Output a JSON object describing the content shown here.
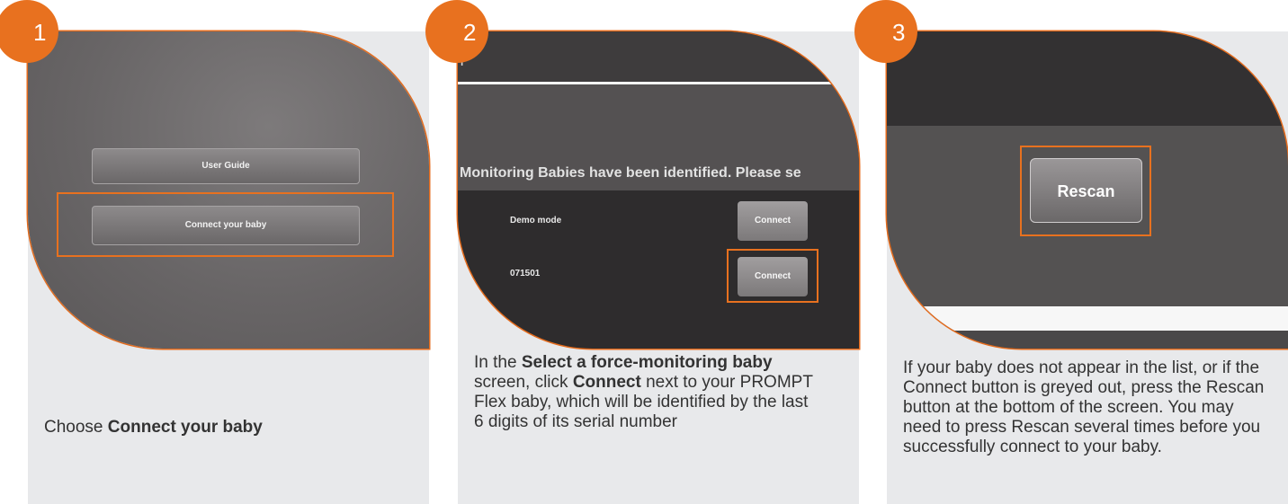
{
  "steps": [
    {
      "number": "1",
      "screen": {
        "buttons": [
          "User Guide",
          "Connect your baby"
        ]
      },
      "caption_prefix": "Choose ",
      "caption_bold": "Connect your baby"
    },
    {
      "number": "2",
      "screen": {
        "message": "Monitoring Babies have been identified. Please se",
        "rows": [
          {
            "label": "Demo mode",
            "button": "Connect"
          },
          {
            "label": "071501",
            "button": "Connect"
          }
        ]
      },
      "caption_parts": {
        "a": "In the ",
        "b": "Select a force-monitoring baby",
        "c": " screen, click ",
        "d": "Connect",
        "e": " next to your PROMPT Flex baby, which will be identified by the last 6 digits of its serial number"
      }
    },
    {
      "number": "3",
      "screen": {
        "button": "Rescan"
      },
      "caption": "If your baby does not appear in the list, or if the Connect button is greyed out, press the Rescan button at the bottom of the screen. You may need to press Rescan several times before you successfully connect to your baby."
    }
  ],
  "colors": {
    "accent": "#e8711f",
    "card_background": "#e8e9eb",
    "text": "#333333"
  }
}
